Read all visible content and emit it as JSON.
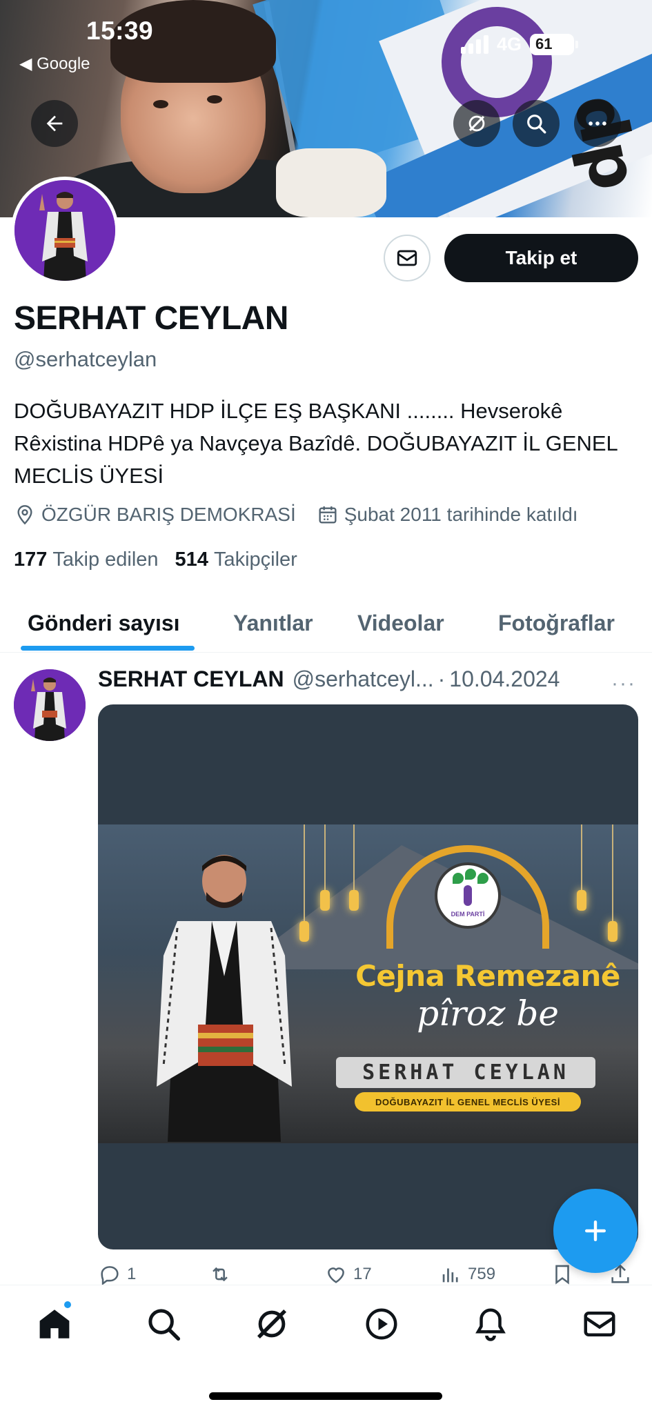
{
  "status_bar": {
    "time": "15:39",
    "back_app": "◀ Google",
    "network": "4G",
    "battery": "61"
  },
  "profile": {
    "display_name": "SERHAT CEYLAN",
    "handle": "@serhatceylan",
    "bio": "DOĞUBAYAZIT HDP İLÇE EŞ BAŞKANI ........ Hevserokê Rêxistina HDPê ya Navçeya Bazîdê. DOĞUBAYAZIT İL GENEL MECLİS ÜYESİ",
    "location": "ÖZGÜR BARIŞ DEMOKRASİ",
    "joined": "Şubat 2011 tarihinde katıldı",
    "following_count": "177",
    "following_label": "Takip edilen",
    "followers_count": "514",
    "followers_label": "Takipçiler",
    "follow_button": "Takip et"
  },
  "tabs": [
    {
      "label": "Gönderi sayısı",
      "active": true
    },
    {
      "label": "Yanıtlar",
      "active": false
    },
    {
      "label": "Videolar",
      "active": false
    },
    {
      "label": "Fotoğraflar",
      "active": false
    }
  ],
  "tweet": {
    "name": "SERHAT CEYLAN",
    "handle": "@serhatceyl...",
    "separator": "·",
    "date": "10.04.2024",
    "more": "···",
    "poster": {
      "logo_text": "DEM PARTİ",
      "title": "Cejna Remezanê",
      "subtitle": "pîroz be",
      "name": "SERHAT CEYLAN",
      "role": "DOĞUBAYAZIT İL GENEL MECLİS ÜYESİ"
    },
    "actions": {
      "replies": "1",
      "retweets": "",
      "likes": "17",
      "views": "759"
    }
  },
  "colors": {
    "accent": "#1d9bf0",
    "text_primary": "#0f1419",
    "text_secondary": "#536471",
    "follow_button_bg": "#0f1419"
  },
  "icons": {
    "banner": [
      "back-arrow-icon",
      "grok-icon",
      "search-icon",
      "more-icon"
    ],
    "nav": [
      "home-icon",
      "search-icon",
      "grok-icon",
      "play-icon",
      "bell-icon",
      "mail-icon"
    ]
  }
}
